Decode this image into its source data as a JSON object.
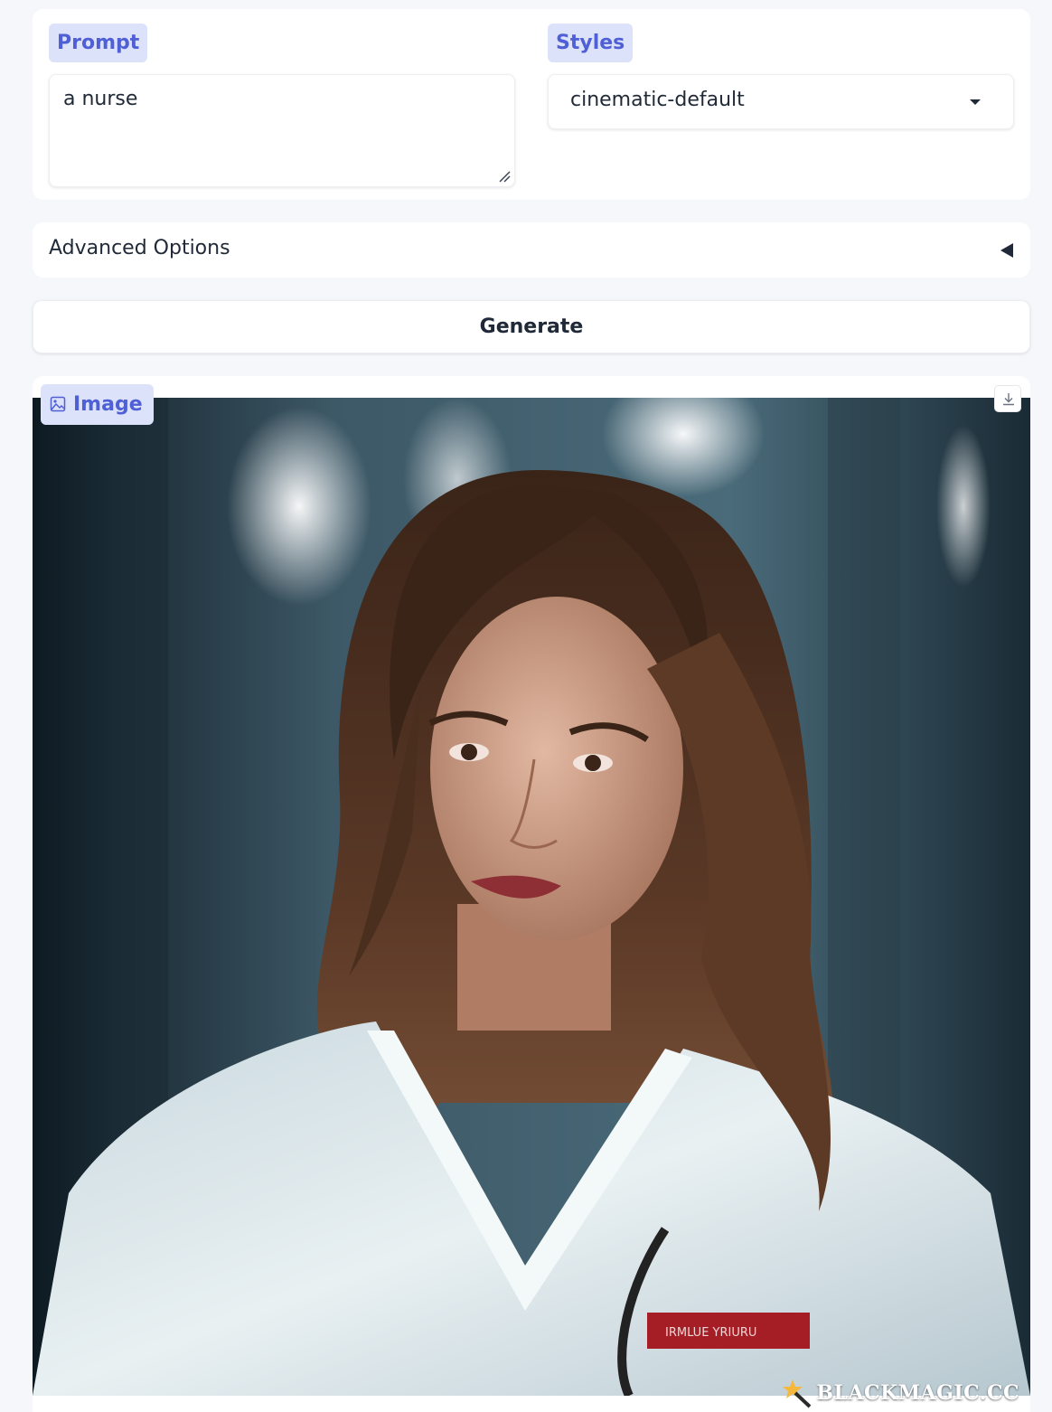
{
  "prompt": {
    "label": "Prompt",
    "value": "a nurse"
  },
  "styles": {
    "label": "Styles",
    "selected": "cinematic-default"
  },
  "advanced": {
    "label": "Advanced Options",
    "state": "collapsed"
  },
  "generate": {
    "label": "Generate"
  },
  "output": {
    "label": "Image",
    "image_alt": "Generated portrait of a nurse in white scrubs with long brown wavy hair and a stethoscope",
    "badge_text": "IRMLUE YRIURU",
    "watermark": "BLACKMAGIC.CC"
  },
  "colors": {
    "accent": "#4f5fd6",
    "chip_bg": "#dde2fb",
    "page_bg": "#f6f7fa",
    "text": "#1f2937"
  }
}
